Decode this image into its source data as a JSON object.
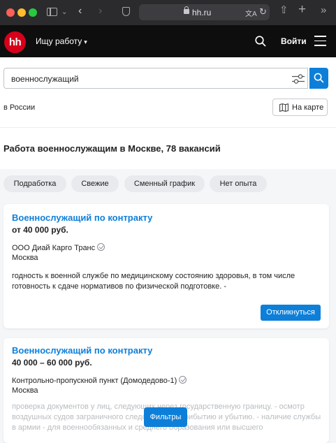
{
  "browser": {
    "url": "hh.ru"
  },
  "header": {
    "logo_text": "hh",
    "job_menu_label": "Ищу работу",
    "login_label": "Войти",
    "logo_color": "#d6001c"
  },
  "search": {
    "value": "военнослужащий",
    "region": "в России",
    "map_button_label": "На карте"
  },
  "results": {
    "title": "Работа военнослужащим в Москве, 78 вакансий"
  },
  "chips": [
    {
      "label": "Подработка"
    },
    {
      "label": "Свежие"
    },
    {
      "label": "Сменный график"
    },
    {
      "label": "Нет опыта"
    }
  ],
  "vacancies": [
    {
      "title": "Военнослужащий по контракту",
      "salary": "от 40 000 руб.",
      "company": "ООО Диай Карго Транс",
      "city": "Москва",
      "description": "годность к военной службе по медицинскому состоянию здоровья, в том числе готовность к сдаче нормативов по физической подготовке. -",
      "respond_label": "Откликнуться"
    },
    {
      "title": "Военнослужащий по контракту",
      "salary": "40 000 – 60 000 руб.",
      "company": "Контрольно-пропускной пункт (Домодедово-1)",
      "city": "Москва",
      "description": "проверка документов у лиц, следующих через государственную границу. - осмотр воздушных судов заграничного следования по прибытию и убытию. - наличие службы в армии - для военнообязанных и среднего образования или высшего"
    }
  ],
  "floating": {
    "filters_label": "Фильтры"
  },
  "accent_color": "#0d7fd9"
}
